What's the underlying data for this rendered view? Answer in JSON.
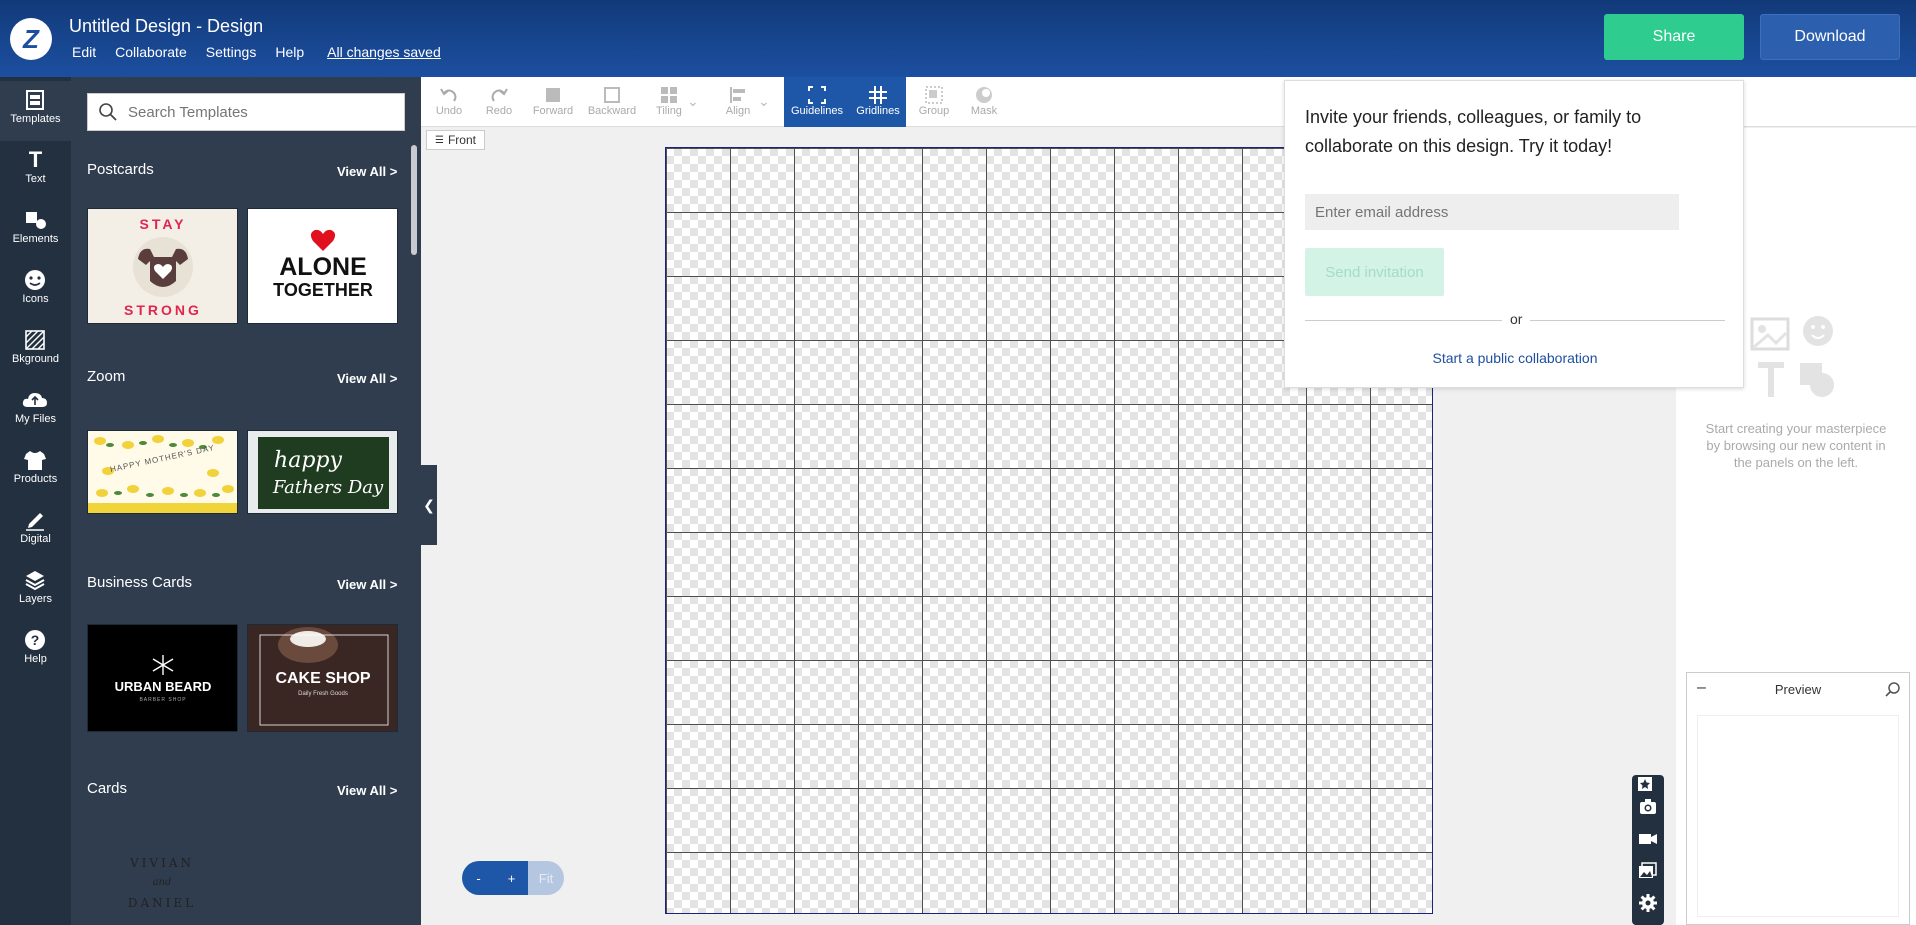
{
  "header": {
    "title": "Untitled Design - Design",
    "menu": [
      "Edit",
      "Collaborate",
      "Settings",
      "Help"
    ],
    "saved_status": "All changes saved",
    "share_label": "Share",
    "download_label": "Download"
  },
  "rail": {
    "items": [
      {
        "label": "Templates",
        "icon": "templates-icon"
      },
      {
        "label": "Text",
        "icon": "text-icon"
      },
      {
        "label": "Elements",
        "icon": "elements-icon"
      },
      {
        "label": "Icons",
        "icon": "icons-icon"
      },
      {
        "label": "Bkground",
        "icon": "background-icon"
      },
      {
        "label": "My Files",
        "icon": "upload-cloud-icon"
      },
      {
        "label": "Products",
        "icon": "tshirt-icon"
      },
      {
        "label": "Digital",
        "icon": "pencil-icon"
      },
      {
        "label": "Layers",
        "icon": "layers-icon"
      },
      {
        "label": "Help",
        "icon": "help-icon"
      }
    ]
  },
  "panel": {
    "search_placeholder": "Search Templates",
    "view_all": "View All >",
    "sections": [
      {
        "title": "Postcards",
        "thumbs": [
          {
            "line1": "STAY",
            "line2": "STRONG"
          },
          {
            "line1": "ALONE",
            "line2": "TOGETHER"
          }
        ]
      },
      {
        "title": "Zoom",
        "thumbs": [
          {
            "line1": "HAPPY MOTHER'S DAY"
          },
          {
            "line1": "happy",
            "line2": "Fathers Day"
          }
        ]
      },
      {
        "title": "Business Cards",
        "thumbs": [
          {
            "line1": "URBAN BEARD",
            "line2": "BARBER SHOP"
          },
          {
            "line1": "CAKE SHOP",
            "line2": "Daily Fresh Goods"
          }
        ]
      },
      {
        "title": "Cards",
        "thumbs": [
          {
            "line1": "VIVIAN",
            "line2": "and",
            "line3": "DANIEL"
          }
        ]
      }
    ]
  },
  "toolbar": {
    "tools": [
      "Undo",
      "Redo",
      "Forward",
      "Backward",
      "Tiling",
      "Align",
      "Guidelines",
      "Gridlines",
      "Group",
      "Mask"
    ],
    "front_tab": "Front"
  },
  "collab": {
    "message": "Invite your friends, colleagues, or family to collaborate on this design. Try it today!",
    "email_placeholder": "Enter email address",
    "send_label": "Send invitation",
    "or_label": "or",
    "public_label": "Start a public collaboration"
  },
  "right_panel": {
    "empty_text": "Start creating your masterpiece by browsing our new content in the panels on the left."
  },
  "preview": {
    "title": "Preview",
    "minimize": "–"
  },
  "zoom": {
    "minus": "-",
    "plus": "+",
    "fit": "Fit"
  },
  "colors": {
    "header": "#1c4fa0",
    "share": "#2ecc8f",
    "download": "#2d5faf",
    "rail": "#233040",
    "panel": "#2f3d4f",
    "active_tool": "#1f57a8"
  }
}
